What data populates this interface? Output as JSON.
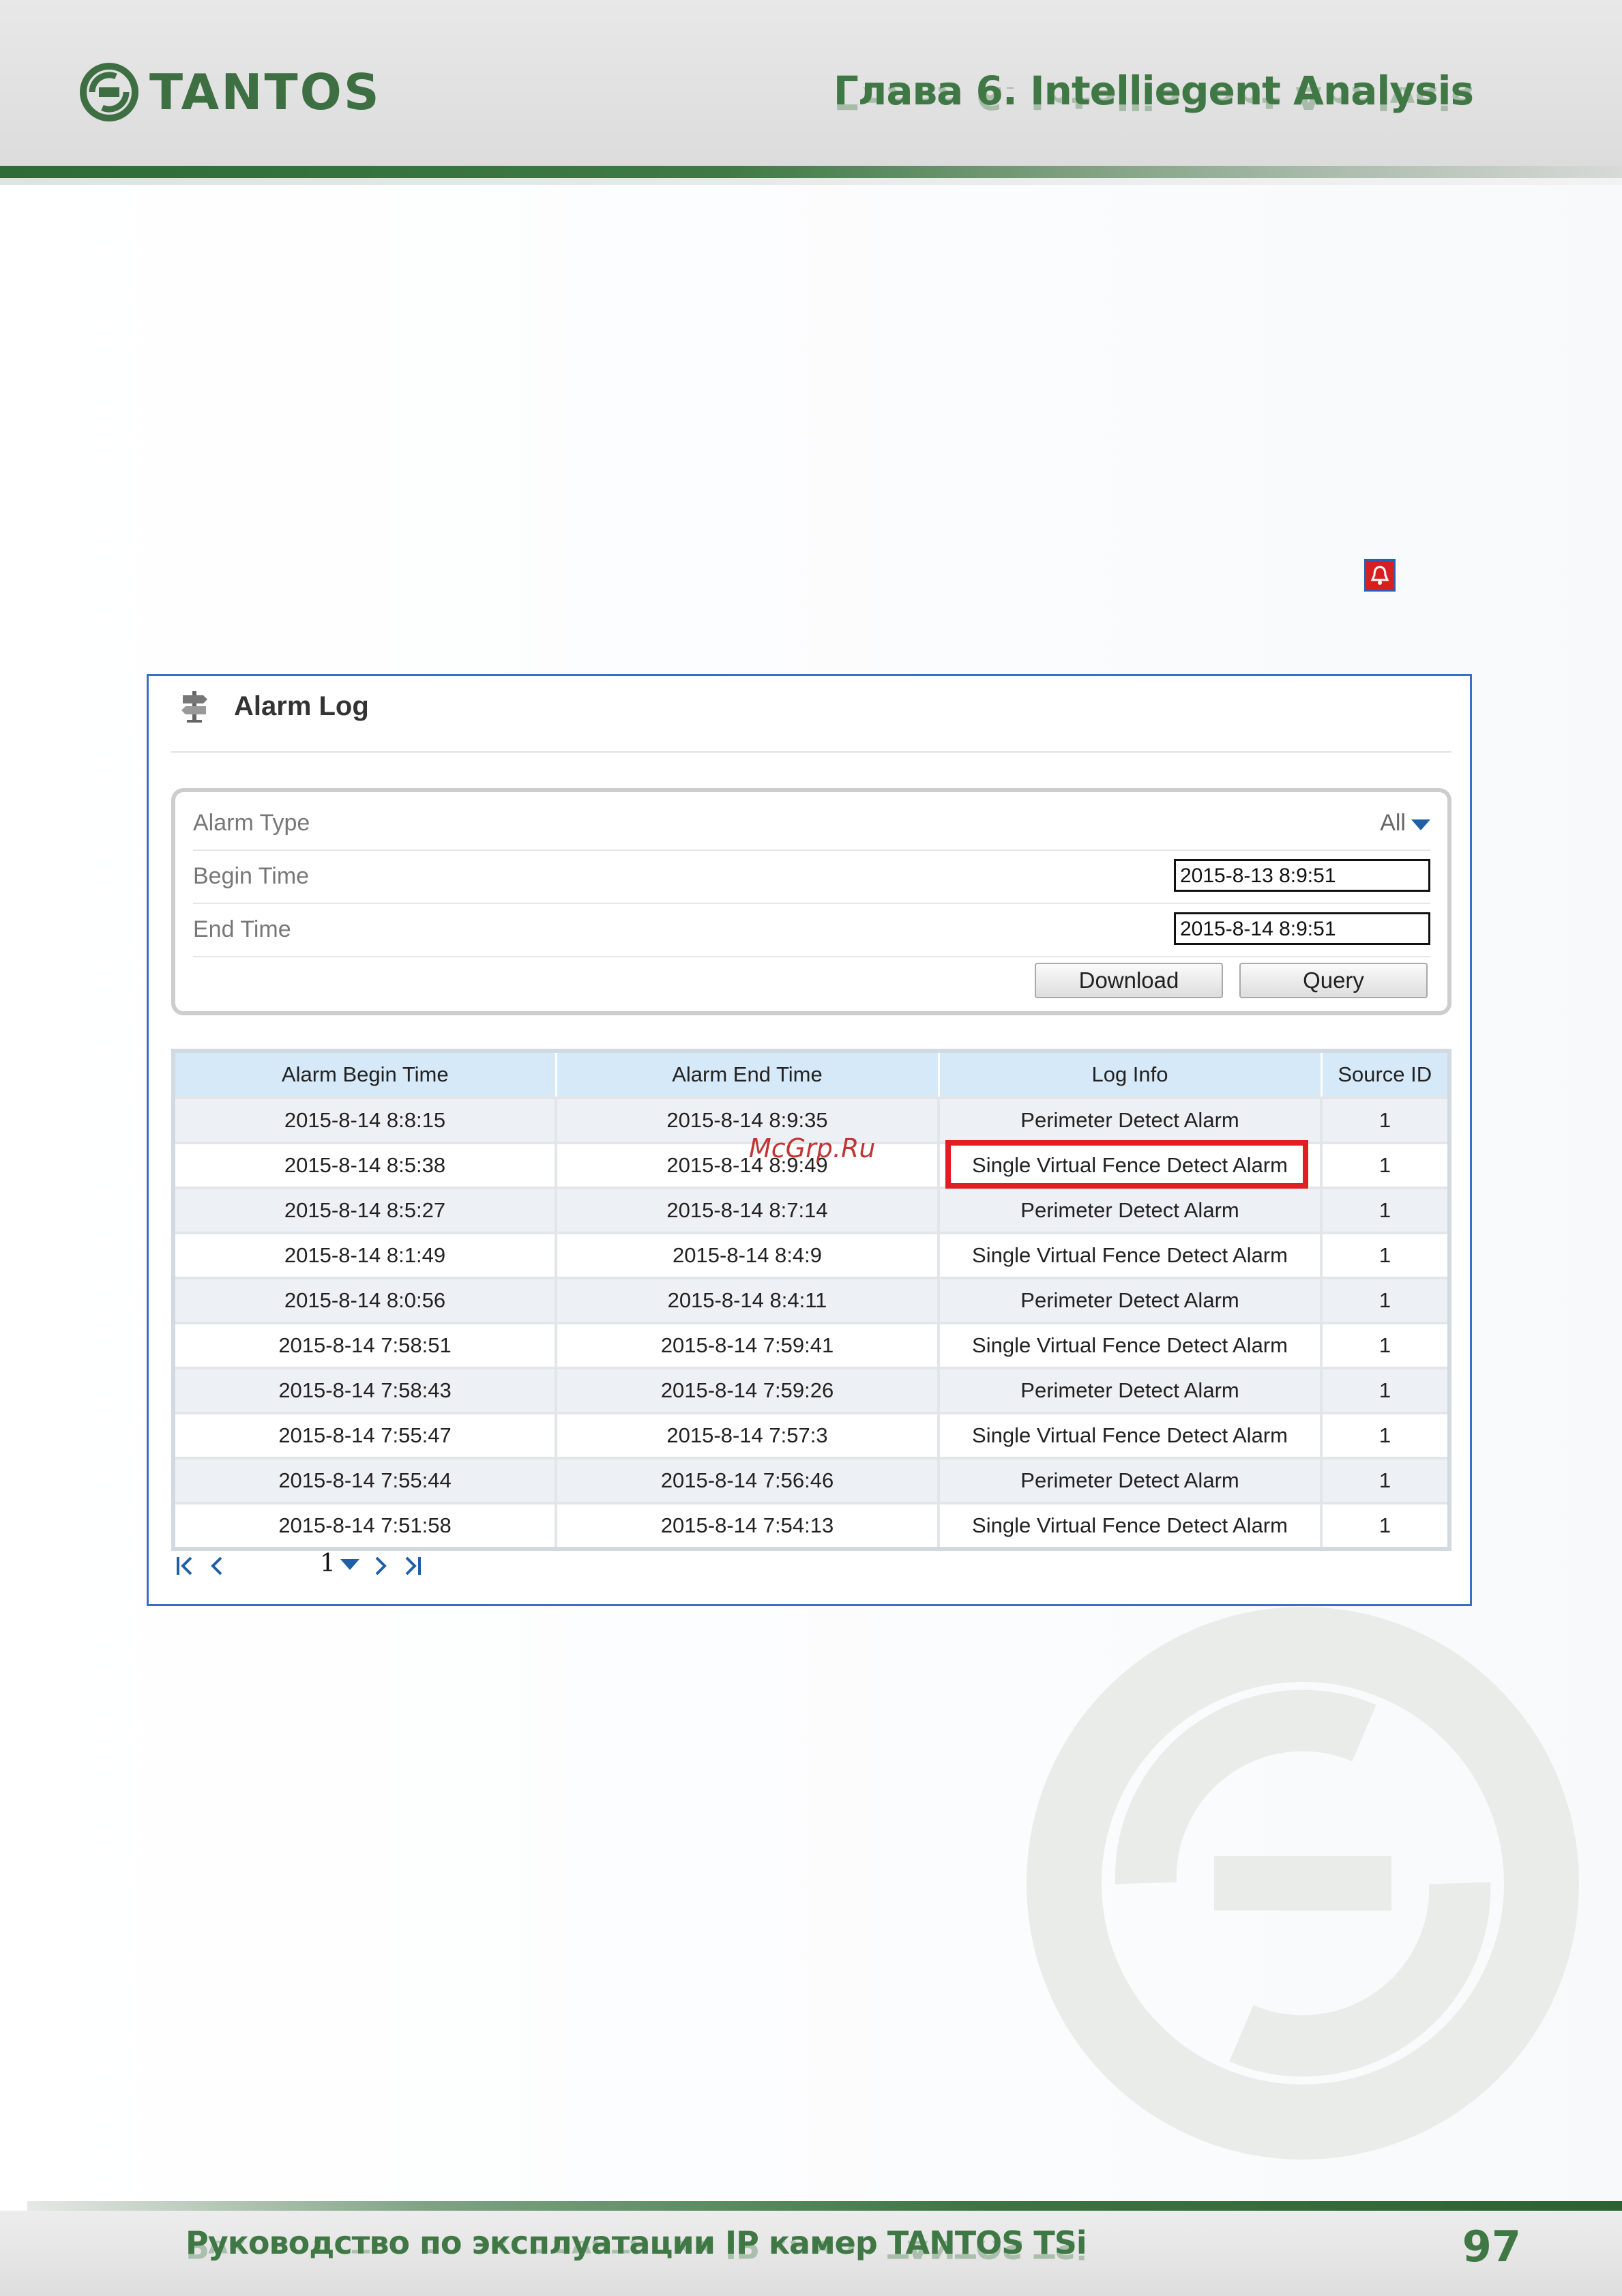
{
  "header": {
    "brand": "TANTOS",
    "chapter": "Глава 6. Intelliegent Analysis",
    "accent_color": "#3f7844"
  },
  "alarm_icon": {
    "name": "alarm-bell-icon",
    "color": "#d81f1f"
  },
  "panel": {
    "title": "Alarm Log",
    "title_icon": "signpost-icon",
    "filters": {
      "alarm_type_label": "Alarm Type",
      "alarm_type_value": "All",
      "begin_time_label": "Begin Time",
      "begin_time_value": "2015-8-13 8:9:51",
      "end_time_label": "End Time",
      "end_time_value": "2015-8-14 8:9:51",
      "download_label": "Download",
      "query_label": "Query"
    },
    "table": {
      "headers": [
        "Alarm Begin Time",
        "Alarm End Time",
        "Log Info",
        "Source ID"
      ],
      "rows": [
        [
          "2015-8-14 8:8:15",
          "2015-8-14 8:9:35",
          "Perimeter Detect Alarm",
          "1"
        ],
        [
          "2015-8-14 8:5:38",
          "2015-8-14 8:9:49",
          "Single Virtual Fence Detect Alarm",
          "1"
        ],
        [
          "2015-8-14 8:5:27",
          "2015-8-14 8:7:14",
          "Perimeter Detect Alarm",
          "1"
        ],
        [
          "2015-8-14 8:1:49",
          "2015-8-14 8:4:9",
          "Single Virtual Fence Detect Alarm",
          "1"
        ],
        [
          "2015-8-14 8:0:56",
          "2015-8-14 8:4:11",
          "Perimeter Detect Alarm",
          "1"
        ],
        [
          "2015-8-14 7:58:51",
          "2015-8-14 7:59:41",
          "Single Virtual Fence Detect Alarm",
          "1"
        ],
        [
          "2015-8-14 7:58:43",
          "2015-8-14 7:59:26",
          "Perimeter Detect Alarm",
          "1"
        ],
        [
          "2015-8-14 7:55:47",
          "2015-8-14 7:57:3",
          "Single Virtual Fence Detect Alarm",
          "1"
        ],
        [
          "2015-8-14 7:55:44",
          "2015-8-14 7:56:46",
          "Perimeter Detect Alarm",
          "1"
        ],
        [
          "2015-8-14 7:51:58",
          "2015-8-14 7:54:13",
          "Single Virtual Fence Detect Alarm",
          "1"
        ]
      ]
    },
    "highlight_color": "#e21d24",
    "pager": {
      "first": "K",
      "prev": "<",
      "page": "1",
      "next": ">",
      "last": ">|"
    },
    "watermark": "McGrp.Ru"
  },
  "footer": {
    "text": "Руководство по эксплуатации IP камер TANTOS TSi",
    "page_number": "97"
  }
}
